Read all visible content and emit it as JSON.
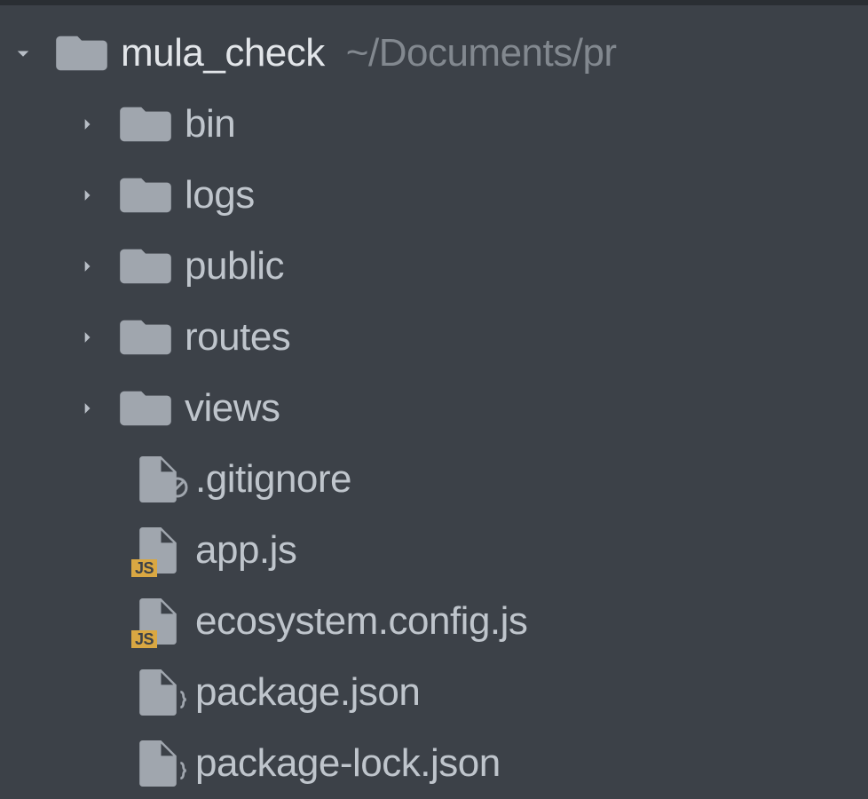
{
  "root": {
    "name": "mula_check",
    "path": "~/Documents/pr",
    "expanded": true
  },
  "folders": [
    {
      "name": "bin"
    },
    {
      "name": "logs"
    },
    {
      "name": "public"
    },
    {
      "name": "routes"
    },
    {
      "name": "views"
    }
  ],
  "files": [
    {
      "name": ".gitignore",
      "type": "ignore"
    },
    {
      "name": "app.js",
      "type": "js"
    },
    {
      "name": "ecosystem.config.js",
      "type": "js"
    },
    {
      "name": "package.json",
      "type": "json"
    },
    {
      "name": "package-lock.json",
      "type": "json"
    }
  ]
}
